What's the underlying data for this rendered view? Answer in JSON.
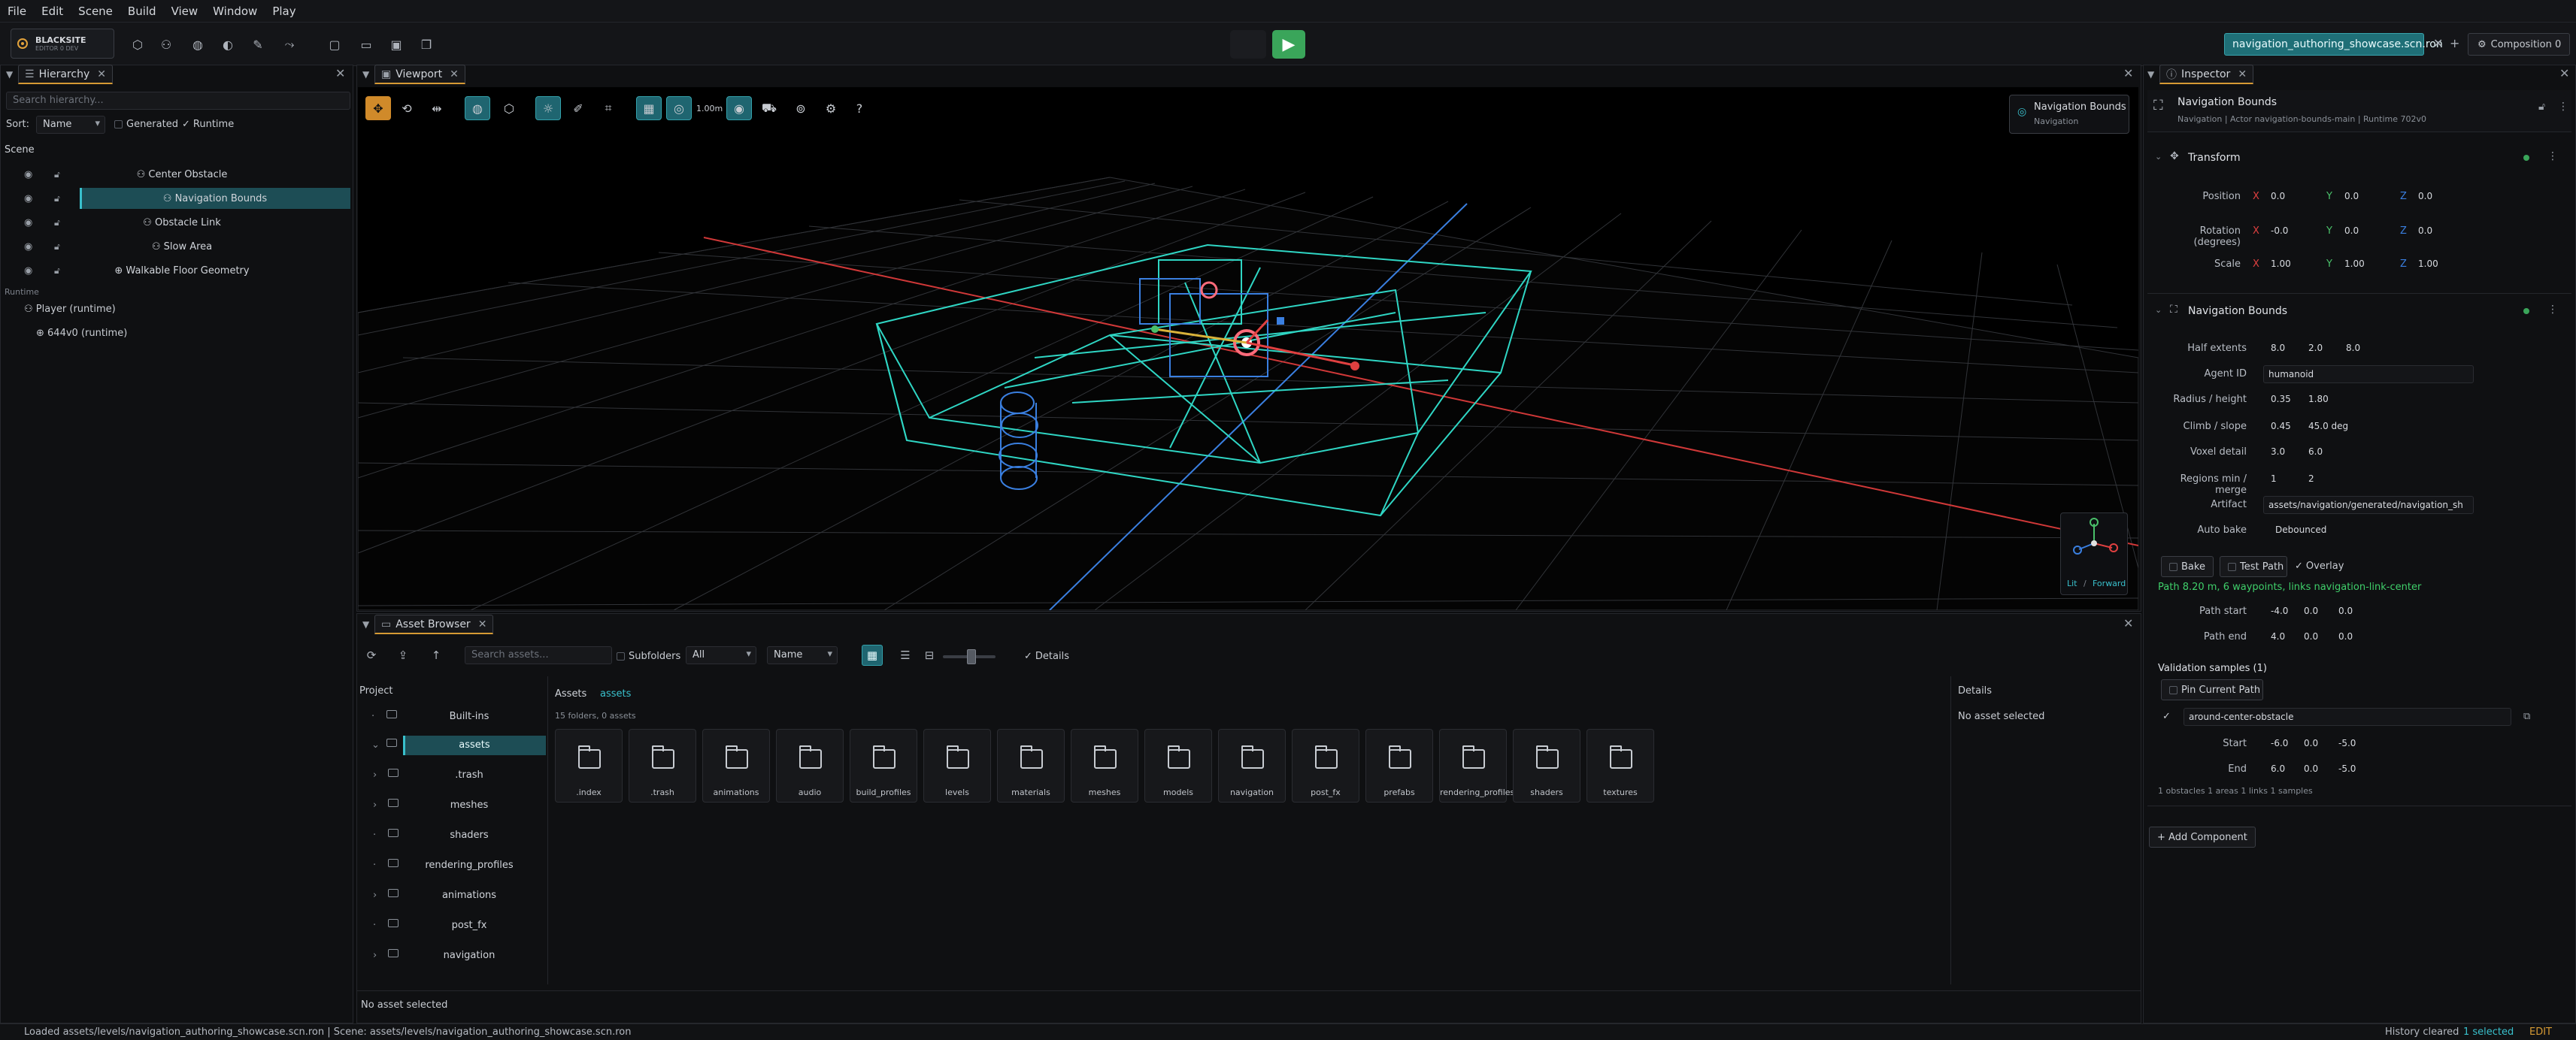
{
  "menu": [
    "File",
    "Edit",
    "Scene",
    "Build",
    "View",
    "Window",
    "Play"
  ],
  "logo": {
    "title": "BLACKSITE",
    "subtitle": "EDITOR 0 DEV"
  },
  "toolbar": {
    "scene_tab": "navigation_authoring_showcase.scn.ron",
    "add_tab": "+",
    "composition": "Composition 0"
  },
  "hierarchy": {
    "tab": "Hierarchy",
    "search_placeholder": "Search hierarchy...",
    "sort_label": "Sort:",
    "sort_value": "Name",
    "generated": "Generated",
    "runtime": "Runtime",
    "scene_label": "Scene",
    "items": [
      "Center Obstacle",
      "Navigation Bounds",
      "Obstacle Link",
      "Slow Area",
      "Walkable Floor Geometry"
    ],
    "runtime_label": "Runtime",
    "runtime_items": [
      "Player (runtime)",
      "644v0 (runtime)"
    ]
  },
  "viewport": {
    "tab": "Viewport",
    "scale_readout": "1.00m",
    "badge_title": "Navigation Bounds",
    "badge_sub": "Navigation",
    "gizmo_lit": "Lit",
    "gizmo_forward": "Forward"
  },
  "assets": {
    "tab": "Asset Browser",
    "search_placeholder": "Search assets...",
    "subfolders": "Subfolders",
    "filter": "All",
    "sort": "Name",
    "details": "Details",
    "project_label": "Project",
    "tree": [
      "Built-ins",
      "assets",
      ".trash",
      "meshes",
      "shaders",
      "rendering_profiles",
      "animations",
      "post_fx",
      "navigation"
    ],
    "breadcrumb_root": "Assets",
    "breadcrumb_current": "assets",
    "count": "15 folders, 0 assets",
    "folders": [
      ".index",
      ".trash",
      "animations",
      "audio",
      "build_profiles",
      "levels",
      "materials",
      "meshes",
      "models",
      "navigation",
      "post_fx",
      "prefabs",
      "rendering_profiles",
      "shaders",
      "textures"
    ],
    "details_title": "Details",
    "details_empty": "No asset selected",
    "footer": "No asset selected"
  },
  "inspector": {
    "tab": "Inspector",
    "entity_name": "Navigation Bounds",
    "entity_meta": "Navigation  |  Actor navigation-bounds-main  |  Runtime 702v0",
    "transform_title": "Transform",
    "position_label": "Position",
    "rotation_label": "Rotation (degrees)",
    "scale_label": "Scale",
    "position": [
      "0.0",
      "0.0",
      "0.0"
    ],
    "rotation": [
      "-0.0",
      "0.0",
      "0.0"
    ],
    "scale": [
      "1.00",
      "1.00",
      "1.00"
    ],
    "nav_title": "Navigation Bounds",
    "half_extents_label": "Half extents",
    "half_extents": [
      "8.0",
      "2.0",
      "8.0"
    ],
    "agent_id_label": "Agent ID",
    "agent_id": "humanoid",
    "radius_label": "Radius / height",
    "radius": [
      "0.35",
      "1.80"
    ],
    "climb_label": "Climb / slope",
    "climb": [
      "0.45",
      "45.0 deg"
    ],
    "voxel_label": "Voxel detail",
    "voxel": [
      "3.0",
      "6.0"
    ],
    "regions_label": "Regions min / merge",
    "regions": [
      "1",
      "2"
    ],
    "artifact_label": "Artifact",
    "artifact": "assets/navigation/generated/navigation_sh",
    "autobake_label": "Auto bake",
    "autobake": "Debounced",
    "bake": "Bake",
    "test_path": "Test Path",
    "overlay": "Overlay",
    "path_status": "Path 8.20 m, 6 waypoints, links navigation-link-center",
    "path_start_label": "Path start",
    "path_start": [
      "-4.0",
      "0.0",
      "0.0"
    ],
    "path_end_label": "Path end",
    "path_end": [
      "4.0",
      "0.0",
      "0.0"
    ],
    "validation_title": "Validation samples (1)",
    "pin_path": "Pin Current Path",
    "sample_name": "around-center-obstacle",
    "start_label": "Start",
    "start": [
      "-6.0",
      "0.0",
      "-5.0"
    ],
    "end_label": "End",
    "end": [
      "6.0",
      "0.0",
      "-5.0"
    ],
    "summary": "1 obstacles  1 areas  1 links  1 samples",
    "add_component": "+ Add Component"
  },
  "status": {
    "left": "Loaded assets/levels/navigation_authoring_showcase.scn.ron  |  Scene: assets/levels/navigation_authoring_showcase.scn.ron",
    "history": "History cleared",
    "selected": "1 selected",
    "mode": "EDIT"
  },
  "colors": {
    "accent": "#39c0cc",
    "orange": "#d69a34",
    "green": "#3aa55a"
  }
}
